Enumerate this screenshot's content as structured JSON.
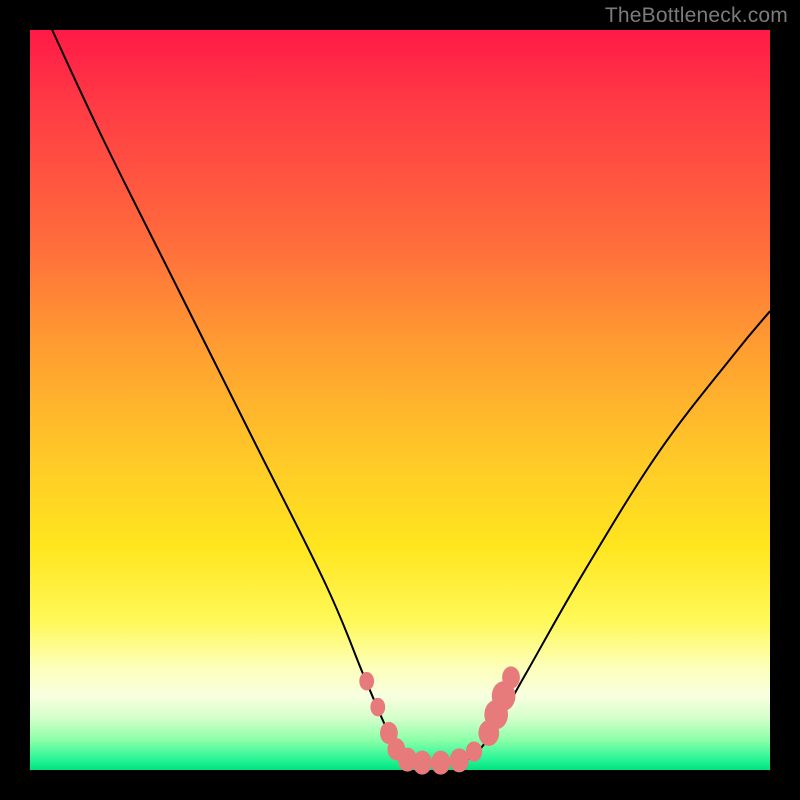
{
  "watermark": "TheBottleneck.com",
  "colors": {
    "frame_bg": "#000000",
    "gradient_top": "#ff1a46",
    "gradient_mid": "#ffe61f",
    "gradient_bottom": "#00e37e",
    "curve": "#000000",
    "marker": "#e77a7a"
  },
  "geometry": {
    "outer_w": 800,
    "outer_h": 800,
    "inner_x": 30,
    "inner_y": 30,
    "inner_w": 740,
    "inner_h": 740
  },
  "chart_data": {
    "type": "line",
    "title": "",
    "xlabel": "",
    "ylabel": "",
    "xlim": [
      0,
      100
    ],
    "ylim": [
      0,
      100
    ],
    "grid": false,
    "legend": false,
    "series": [
      {
        "name": "bottleneck-curve",
        "x": [
          3,
          10,
          20,
          30,
          40,
          45,
          48,
          50,
          53,
          57,
          60,
          63,
          67,
          75,
          85,
          95,
          100
        ],
        "y": [
          100,
          85,
          65,
          45,
          25,
          13,
          6,
          2,
          1,
          1,
          2,
          6,
          13,
          27,
          43,
          56,
          62
        ]
      }
    ],
    "markers": {
      "name": "highlight-points",
      "color": "#e77a7a",
      "points": [
        {
          "x": 45.5,
          "y": 12.0,
          "r": 1.0
        },
        {
          "x": 47.0,
          "y": 8.5,
          "r": 1.0
        },
        {
          "x": 48.5,
          "y": 5.0,
          "r": 1.2
        },
        {
          "x": 49.5,
          "y": 2.8,
          "r": 1.2
        },
        {
          "x": 51.0,
          "y": 1.4,
          "r": 1.3
        },
        {
          "x": 53.0,
          "y": 1.0,
          "r": 1.3
        },
        {
          "x": 55.5,
          "y": 1.0,
          "r": 1.3
        },
        {
          "x": 58.0,
          "y": 1.3,
          "r": 1.3
        },
        {
          "x": 60.0,
          "y": 2.5,
          "r": 1.1
        },
        {
          "x": 62.0,
          "y": 5.0,
          "r": 1.4
        },
        {
          "x": 63.0,
          "y": 7.5,
          "r": 1.6
        },
        {
          "x": 64.0,
          "y": 10.0,
          "r": 1.6
        },
        {
          "x": 65.0,
          "y": 12.5,
          "r": 1.2
        }
      ]
    }
  }
}
